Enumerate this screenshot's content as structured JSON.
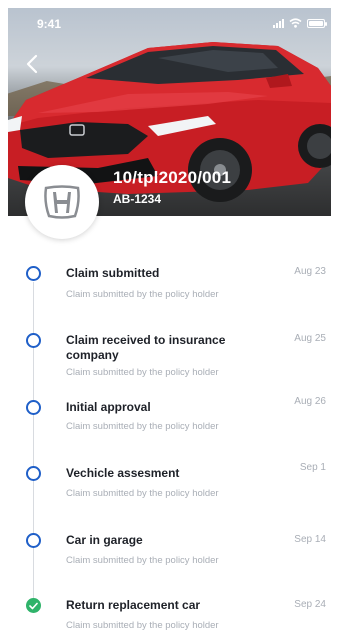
{
  "status_bar": {
    "time": "9:41",
    "icons": [
      "signal-icon",
      "wifi-icon",
      "battery-icon"
    ]
  },
  "header": {
    "back_icon": "chevron-left-icon",
    "brand_logo": "honda-logo",
    "vehicle_id": "10/tpl2020/001",
    "plate": "AB-1234"
  },
  "timeline": {
    "items": [
      {
        "title": "Claim submitted",
        "description": "Claim submitted by the policy holder",
        "date": "Aug 23",
        "status": "pending"
      },
      {
        "title": "Claim received to insurance company",
        "description": "Claim submitted by the policy holder",
        "date": "Aug 25",
        "status": "pending"
      },
      {
        "title": "Initial approval",
        "description": "Claim submitted by the policy holder",
        "date": "Aug 26",
        "status": "pending"
      },
      {
        "title": "Vechicle assesment",
        "description": "Claim submitted by the policy holder",
        "date": "Sep 1",
        "status": "pending"
      },
      {
        "title": "Car in garage",
        "description": "Claim submitted by the policy holder",
        "date": "Sep 14",
        "status": "pending"
      },
      {
        "title": "Return replacement car",
        "description": "Claim submitted by the policy holder",
        "date": "Sep 24",
        "status": "done"
      }
    ]
  },
  "colors": {
    "marker_pending": "#1f5fc8",
    "marker_done": "#2fb36a",
    "title_text": "#1e2128",
    "muted_text": "#a9aeb6"
  }
}
